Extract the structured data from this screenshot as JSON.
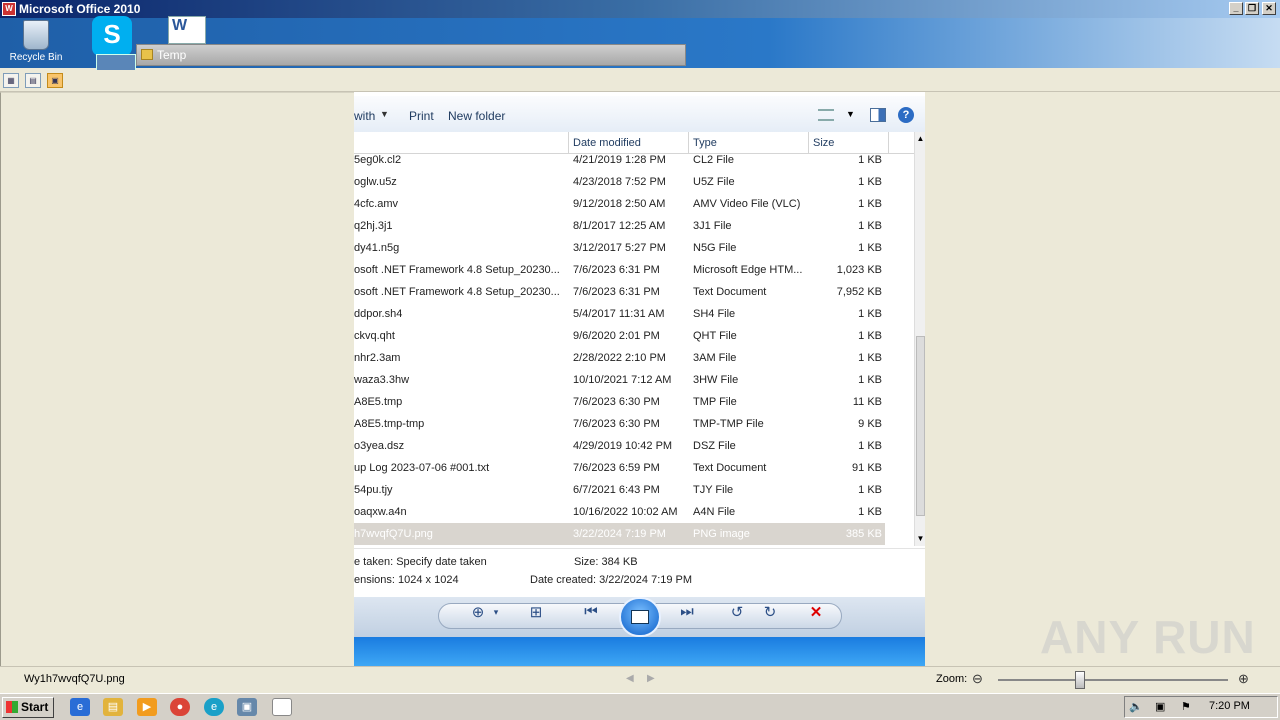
{
  "window": {
    "title": "Microsoft Office 2010"
  },
  "desktop": {
    "recycle_bin_label": "Recycle Bin",
    "temp_window_title": "Temp"
  },
  "toolbar": {
    "open_with_label": "with",
    "print_label": "Print",
    "new_folder_label": "New folder"
  },
  "columns": {
    "name": "",
    "date": "Date modified",
    "type": "Type",
    "size": "Size"
  },
  "files": [
    {
      "name": "5eg0k.cl2",
      "date": "4/21/2019 1:28 PM",
      "type": "CL2 File",
      "size": "1 KB"
    },
    {
      "name": "oglw.u5z",
      "date": "4/23/2018 7:52 PM",
      "type": "U5Z File",
      "size": "1 KB"
    },
    {
      "name": "4cfc.amv",
      "date": "9/12/2018 2:50 AM",
      "type": "AMV Video File (VLC)",
      "size": "1 KB"
    },
    {
      "name": "q2hj.3j1",
      "date": "8/1/2017 12:25 AM",
      "type": "3J1 File",
      "size": "1 KB"
    },
    {
      "name": "dy41.n5g",
      "date": "3/12/2017 5:27 PM",
      "type": "N5G File",
      "size": "1 KB"
    },
    {
      "name": "osoft .NET Framework 4.8 Setup_20230...",
      "date": "7/6/2023 6:31 PM",
      "type": "Microsoft Edge HTM...",
      "size": "1,023 KB"
    },
    {
      "name": "osoft .NET Framework 4.8 Setup_20230...",
      "date": "7/6/2023 6:31 PM",
      "type": "Text Document",
      "size": "7,952 KB"
    },
    {
      "name": "ddpor.sh4",
      "date": "5/4/2017 11:31 AM",
      "type": "SH4 File",
      "size": "1 KB"
    },
    {
      "name": "ckvq.qht",
      "date": "9/6/2020 2:01 PM",
      "type": "QHT File",
      "size": "1 KB"
    },
    {
      "name": "nhr2.3am",
      "date": "2/28/2022 2:10 PM",
      "type": "3AM File",
      "size": "1 KB"
    },
    {
      "name": "waza3.3hw",
      "date": "10/10/2021 7:12 AM",
      "type": "3HW File",
      "size": "1 KB"
    },
    {
      "name": "A8E5.tmp",
      "date": "7/6/2023 6:30 PM",
      "type": "TMP File",
      "size": "11 KB"
    },
    {
      "name": "A8E5.tmp-tmp",
      "date": "7/6/2023 6:30 PM",
      "type": "TMP-TMP File",
      "size": "9 KB"
    },
    {
      "name": "o3yea.dsz",
      "date": "4/29/2019 10:42 PM",
      "type": "DSZ File",
      "size": "1 KB"
    },
    {
      "name": "up Log 2023-07-06 #001.txt",
      "date": "7/6/2023 6:59 PM",
      "type": "Text Document",
      "size": "91 KB"
    },
    {
      "name": "54pu.tjy",
      "date": "6/7/2021 6:43 PM",
      "type": "TJY File",
      "size": "1 KB"
    },
    {
      "name": "oaqxw.a4n",
      "date": "10/16/2022 10:02 AM",
      "type": "A4N File",
      "size": "1 KB"
    },
    {
      "name": "h7wvqfQ7U.png",
      "date": "3/22/2024 7:19 PM",
      "type": "PNG image",
      "size": "385 KB"
    }
  ],
  "details": {
    "date_taken": "e taken: Specify date taken",
    "size": "Size: 384 KB",
    "dimensions": "ensions: 1024 x 1024",
    "date_created": "Date created: 3/22/2024 7:19 PM"
  },
  "statusbar": {
    "filename": "Wy1h7wvqfQ7U.png",
    "zoom_label": "Zoom:"
  },
  "watermark": "ANY RUN",
  "taskbar": {
    "start_label": "Start",
    "clock": "7:20 PM"
  },
  "colors": {
    "selected_row": "#d9d5cf",
    "accent": "#2c6cc4"
  }
}
